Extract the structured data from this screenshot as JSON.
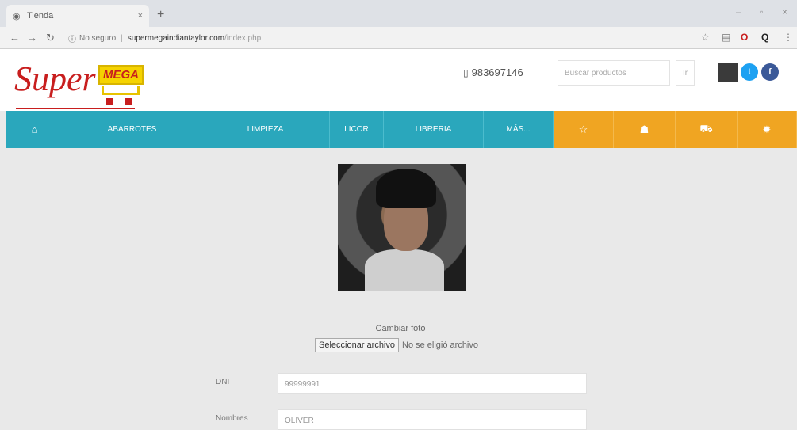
{
  "browser": {
    "tab_title": "Tienda",
    "url_security": "No seguro",
    "url_host": "supermegaindiantaylor.com",
    "url_path": "/index.php"
  },
  "header": {
    "logo_super": "Super",
    "logo_mega": "MEGA",
    "phone": "983697146",
    "search_placeholder": "Buscar productos",
    "search_button": "Ir"
  },
  "nav": {
    "items": [
      {
        "label": "ABARROTES"
      },
      {
        "label": "LIMPIEZA"
      },
      {
        "label": "LICOR"
      },
      {
        "label": "LIBRERIA"
      },
      {
        "label": "MÁS..."
      }
    ]
  },
  "profile": {
    "change_photo_label": "Cambiar foto",
    "file_button": "Seleccionar archivo",
    "file_status": "No se eligió archivo",
    "fields": [
      {
        "label": "DNI",
        "value": "99999991"
      },
      {
        "label": "Nombres",
        "value": "OLIVER"
      }
    ]
  },
  "colors": {
    "nav_teal": "#2aa7bc",
    "nav_orange": "#f0a522",
    "logo_red": "#c81e1e",
    "twitter": "#1da1f2",
    "facebook": "#3b5998"
  }
}
